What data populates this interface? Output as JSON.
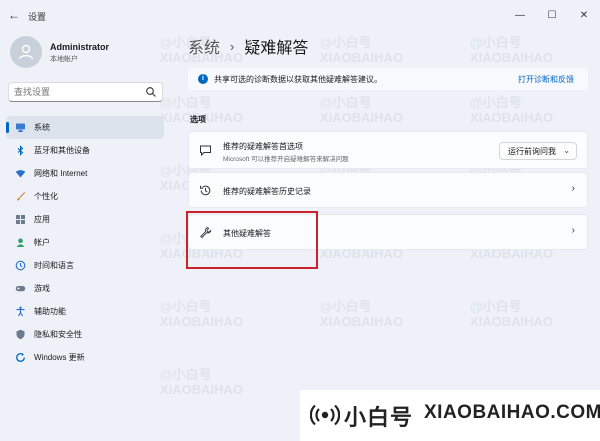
{
  "window": {
    "title": "设置",
    "back_glyph": "←",
    "minimize_glyph": "—",
    "maximize_glyph": "☐",
    "close_glyph": "✕"
  },
  "user": {
    "name": "Administrator",
    "account_type": "本地帐户"
  },
  "search": {
    "placeholder": "查找设置"
  },
  "nav": {
    "items": [
      {
        "label": "系统",
        "icon": "monitor-icon",
        "active": true
      },
      {
        "label": "蓝牙和其他设备",
        "icon": "bluetooth-icon"
      },
      {
        "label": "网络和 Internet",
        "icon": "wifi-icon"
      },
      {
        "label": "个性化",
        "icon": "paintbrush-icon"
      },
      {
        "label": "应用",
        "icon": "apps-icon"
      },
      {
        "label": "帐户",
        "icon": "account-icon"
      },
      {
        "label": "时间和语言",
        "icon": "globe-clock-icon"
      },
      {
        "label": "游戏",
        "icon": "gamepad-icon"
      },
      {
        "label": "辅助功能",
        "icon": "accessibility-icon"
      },
      {
        "label": "隐私和安全性",
        "icon": "shield-icon"
      },
      {
        "label": "Windows 更新",
        "icon": "windows-update-icon"
      }
    ]
  },
  "breadcrumb": {
    "parent": "系统",
    "separator": "›",
    "current": "疑难解答"
  },
  "banner": {
    "icon": "i",
    "text": "共享可选的诊断数据以获取其他疑难解答建议。",
    "link": "打开诊断和反馈"
  },
  "section": {
    "label": "选项"
  },
  "cards": {
    "recommended": {
      "title": "推荐的疑难解答首选项",
      "subtitle": "Microsoft 可以推荐开启疑难解答来解决问题",
      "select_value": "运行前询问我",
      "chevron": "⌄"
    },
    "history": {
      "title": "推荐的疑难解答历史记录",
      "chevron": "›"
    },
    "other": {
      "title": "其他疑难解答",
      "chevron": "›"
    }
  },
  "watermark": {
    "cn_text": "小白号",
    "en_text": "XIAOBAIHAO.COM",
    "tile_cn": "@小白号",
    "tile_en": "XIAOBAIHAO",
    "color": "#222222"
  },
  "colors": {
    "accent": "#0067c0",
    "highlight_box": "#c8232c",
    "background": "#eef2f8"
  }
}
